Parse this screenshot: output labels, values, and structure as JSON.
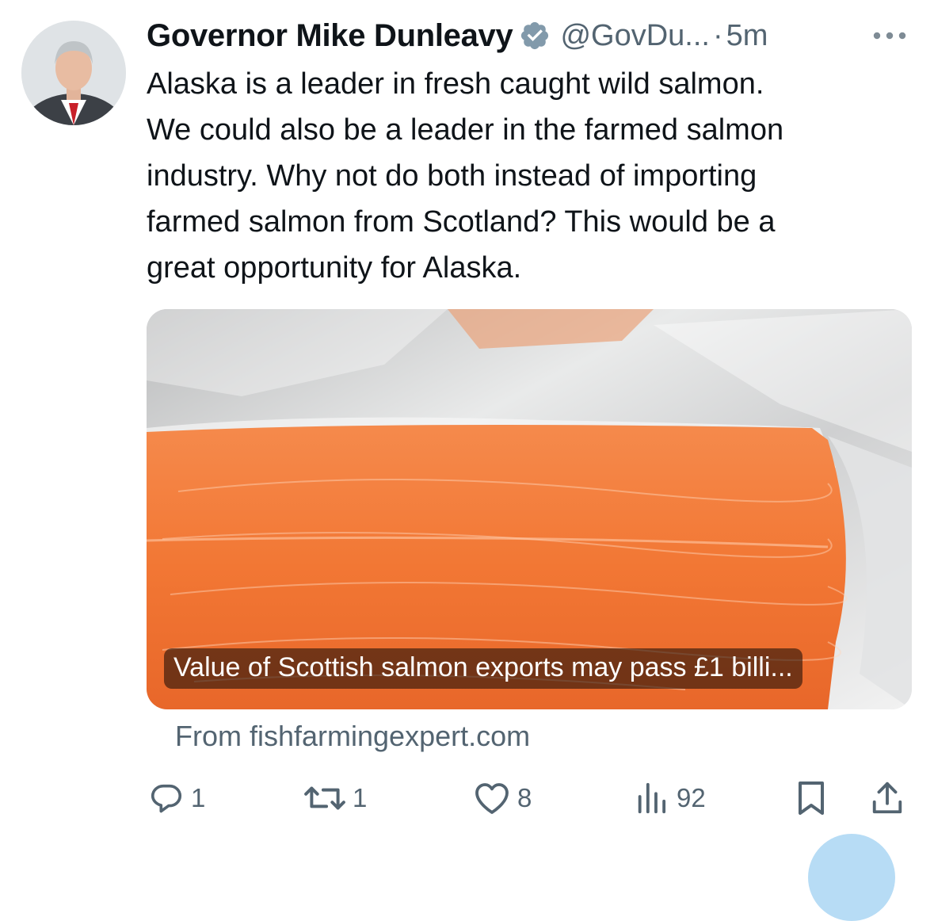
{
  "tweet": {
    "author": {
      "display_name": "Governor Mike Dunleavy",
      "handle": "@GovDu...",
      "verified": true,
      "avatar_icon": "profile-photo"
    },
    "separator": "·",
    "time": "5m",
    "more_icon": "more-dots-icon",
    "text_lines": [
      "Alaska is a leader in fresh caught wild salmon.",
      "We could also be a leader in the farmed salmon",
      "industry. Why not do both instead of importing",
      "farmed salmon from Scotland? This would be a",
      "great opportunity for Alaska."
    ],
    "card": {
      "image_icon": "salmon-fillet-photo",
      "caption": "Value of Scottish salmon exports may pass £1 billi...",
      "source": "From fishfarmingexpert.com"
    },
    "actions": {
      "replies": {
        "icon": "reply-icon",
        "count": "1"
      },
      "reposts": {
        "icon": "repost-icon",
        "count": "1"
      },
      "likes": {
        "icon": "heart-icon",
        "count": "8"
      },
      "views": {
        "icon": "views-icon",
        "count": "92"
      },
      "bookmark": {
        "icon": "bookmark-icon"
      },
      "share": {
        "icon": "share-icon"
      }
    }
  },
  "colors": {
    "text_primary": "#0f1419",
    "text_secondary": "#536471",
    "verified_badge": "#829aab",
    "salmon": "#f07a3c"
  }
}
